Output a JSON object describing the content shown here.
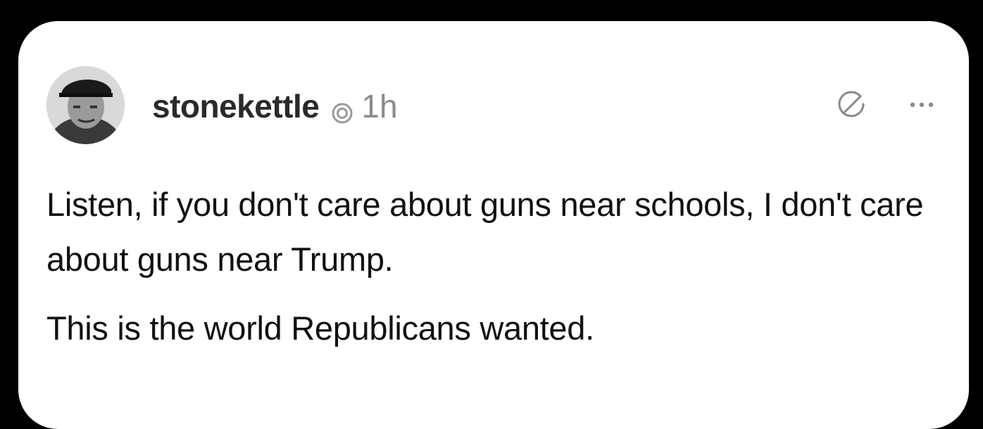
{
  "post": {
    "author": {
      "username": "stonekettle",
      "timestamp": "1h",
      "avatar": "avatar-photo"
    },
    "icons": {
      "thread_indicator": "threads-icon",
      "edit": "edit-icon",
      "more": "more-options-icon"
    },
    "body": {
      "paragraph_1": "Listen, if you don't care about guns near schools, I don't care about guns near Trump.",
      "paragraph_2": "This is the world Republicans wanted."
    }
  },
  "colors": {
    "background": "#000000",
    "card": "#ffffff",
    "username": "#2a2a2a",
    "timestamp": "#8a8a8a",
    "body_text": "#111111"
  }
}
